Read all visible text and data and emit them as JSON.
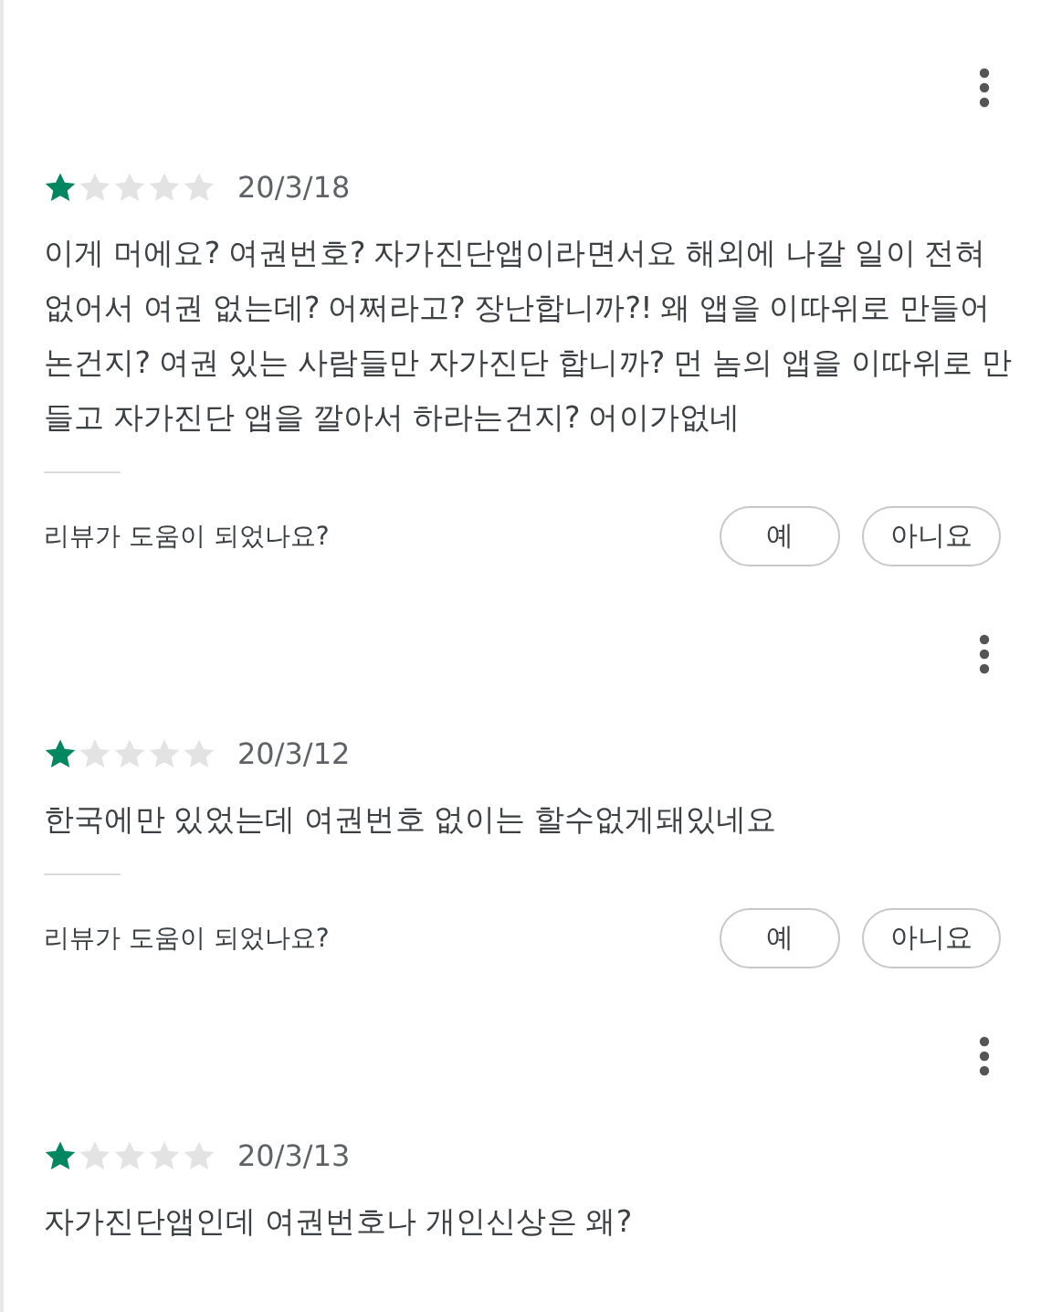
{
  "reviews": [
    {
      "stars": 1,
      "date": "20/3/18",
      "text": "이게 머에요? 여권번호? 자가진단앱이라면서요 해외에 나갈 일이 전혀 없어서 여권 없는데? 어쩌라고? 장난합니까?! 왜 앱을 이따위로 만들어논건지? 여권 있는 사람들만 자가진단 합니까? 먼 놈의 앱을 이따위로 만들고 자가진단 앱을 깔아서 하라는건지? 어이가없네",
      "helpful": {
        "question": "리뷰가 도움이 되었나요?",
        "yes": "예",
        "no": "아니요"
      }
    },
    {
      "stars": 1,
      "date": "20/3/12",
      "text": "한국에만 있었는데 여권번호 없이는 할수없게돼있네요",
      "helpful": {
        "question": "리뷰가 도움이 되었나요?",
        "yes": "예",
        "no": "아니요"
      }
    },
    {
      "stars": 1,
      "date": "20/3/13",
      "text": "자가진단앱인데 여권번호나 개인신상은 왜?"
    }
  ]
}
